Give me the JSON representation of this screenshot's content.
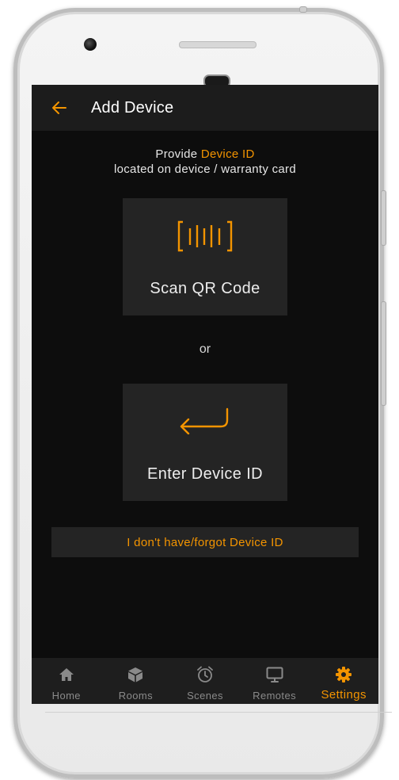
{
  "app": {
    "title": "Add Device"
  },
  "prompt": {
    "prefix": "Provide ",
    "highlight": "Device ID",
    "line2": "located on device / warranty card"
  },
  "actions": {
    "scan_label": "Scan QR Code",
    "or_label": "or",
    "enter_label": "Enter Device ID",
    "forgot_label": "I don't have/forgot Device ID"
  },
  "tabs": [
    {
      "label": "Home",
      "icon": "home-icon",
      "active": false
    },
    {
      "label": "Rooms",
      "icon": "cube-icon",
      "active": false
    },
    {
      "label": "Scenes",
      "icon": "alarm-clock-icon",
      "active": false
    },
    {
      "label": "Remotes",
      "icon": "monitor-icon",
      "active": false
    },
    {
      "label": "Settings",
      "icon": "gear-icon",
      "active": true
    }
  ],
  "colors": {
    "accent": "#f39400",
    "background": "#0d0d0d",
    "surface": "#242424",
    "appbar": "#1c1c1c",
    "inactive_tab": "#8a8a8a"
  }
}
